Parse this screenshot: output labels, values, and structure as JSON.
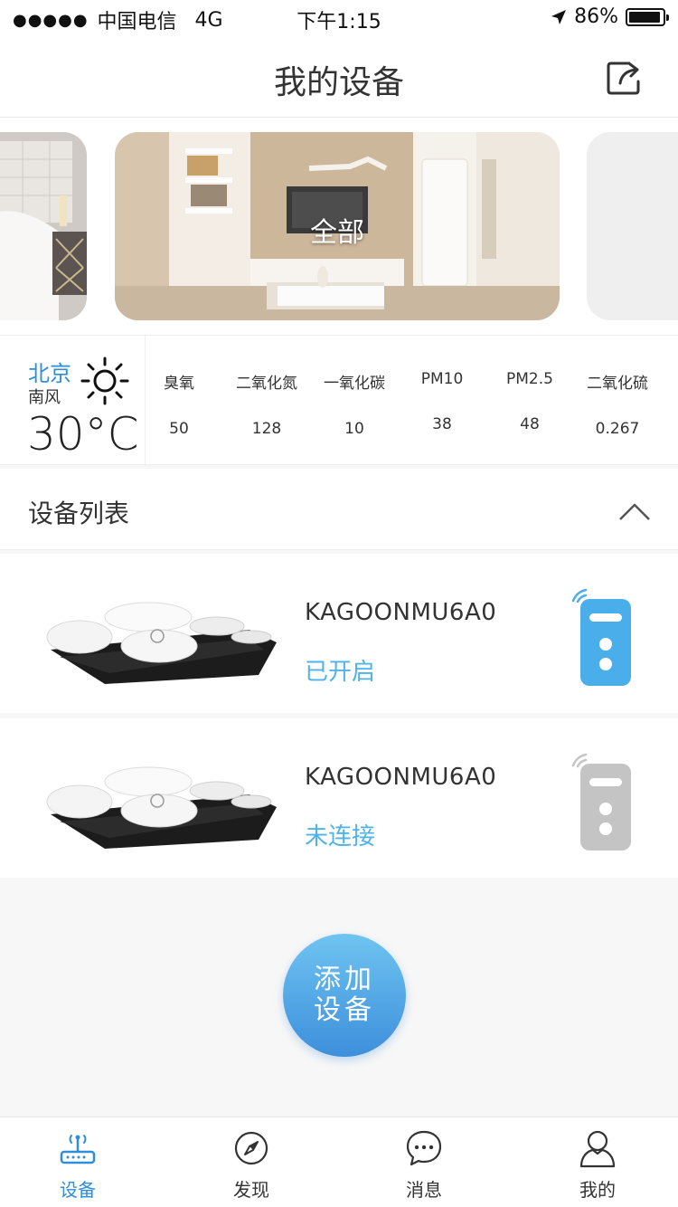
{
  "status_bar": {
    "carrier": "中国电信",
    "network": "4G",
    "time": "下午1:15",
    "battery": "86%",
    "signal_dots": "●●●●●"
  },
  "nav": {
    "title": "我的设备",
    "share_icon": "share-icon"
  },
  "banner": {
    "current_room": "全部"
  },
  "weather": {
    "city": "北京",
    "wind": "南风",
    "temperature": "30°C",
    "icon": "sun-icon",
    "metrics": [
      {
        "label": "臭氧",
        "value": "50"
      },
      {
        "label": "二氧化氮",
        "value": "128"
      },
      {
        "label": "一氧化碳",
        "value": "10"
      },
      {
        "label": "PM10",
        "value": "38"
      },
      {
        "label": "PM2.5",
        "value": "48"
      },
      {
        "label": "二氧化硫",
        "value": "0.267"
      }
    ]
  },
  "device_list": {
    "title": "设备列表",
    "devices": [
      {
        "name": "KAGOONMU6A0",
        "status": "已开启",
        "remote_color": "#4aaeea"
      },
      {
        "name": "KAGOONMU6A0",
        "status": "未连接",
        "remote_color": "#c4c4c4"
      }
    ]
  },
  "add_button": {
    "line1": "添加",
    "line2": "设备"
  },
  "tabbar": {
    "tabs": [
      {
        "label": "设备",
        "icon": "router-icon",
        "active": true
      },
      {
        "label": "发现",
        "icon": "compass-icon",
        "active": false
      },
      {
        "label": "消息",
        "icon": "chat-icon",
        "active": false
      },
      {
        "label": "我的",
        "icon": "user-icon",
        "active": false
      }
    ]
  },
  "colors": {
    "accent": "#2f8ed6",
    "status_on": "#4fb3e8",
    "remote_on": "#4aaeea",
    "remote_off": "#c4c4c4"
  }
}
